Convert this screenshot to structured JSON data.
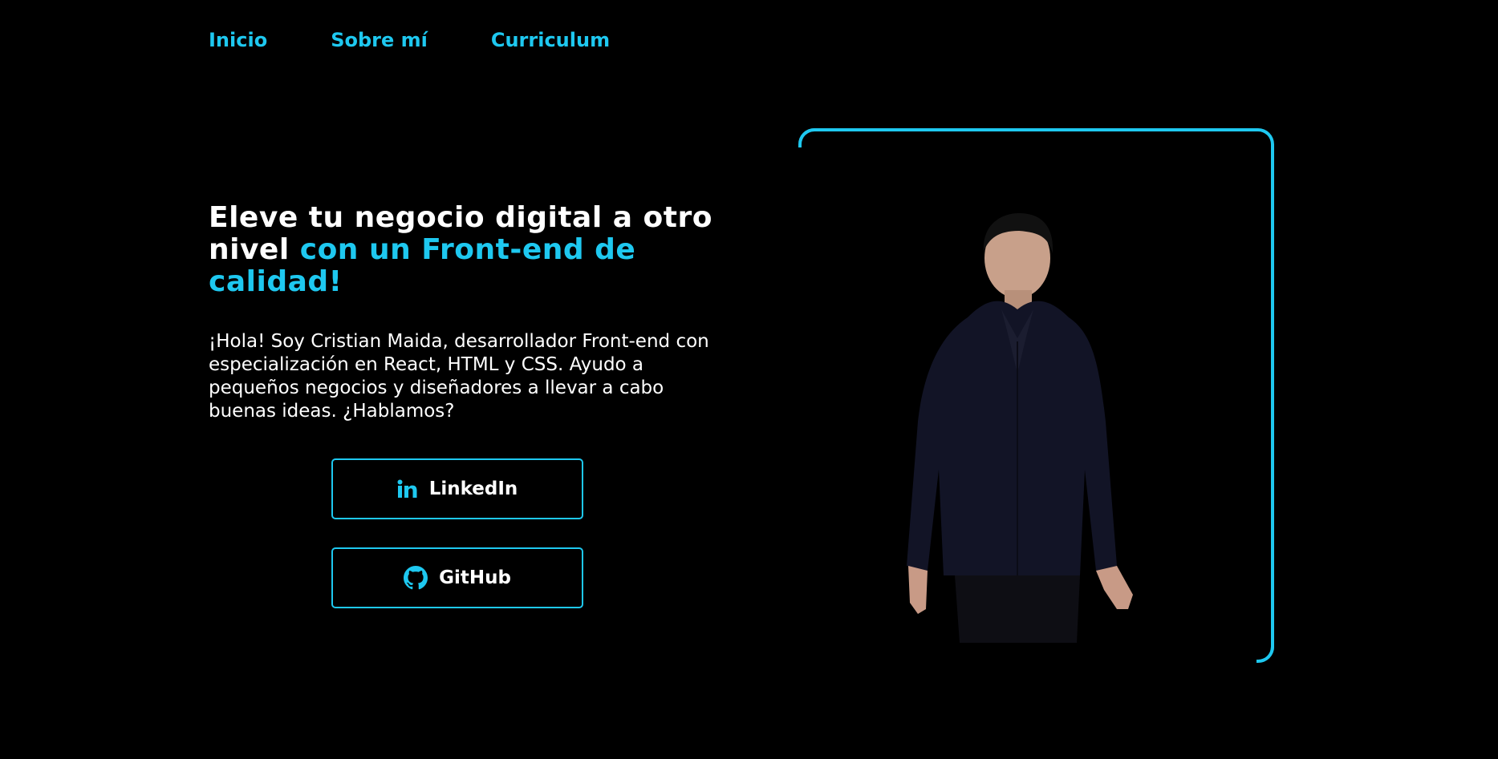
{
  "nav": {
    "items": [
      {
        "label": "Inicio"
      },
      {
        "label": "Sobre mí"
      },
      {
        "label": "Curriculum"
      }
    ]
  },
  "hero": {
    "headline_part1": "Eleve tu negocio digital a otro nivel ",
    "headline_part2": "con un Front-end de calidad!",
    "intro": "¡Hola! Soy Cristian Maida, desarrollador Front-end con especialización en React, HTML y CSS. Ayudo a pequeños negocios y diseñadores a llevar a cabo buenas ideas. ¿Hablamos?"
  },
  "buttons": {
    "linkedin": {
      "label": "LinkedIn",
      "icon": "linkedin-icon"
    },
    "github": {
      "label": "GitHub",
      "icon": "github-icon"
    }
  },
  "colors": {
    "accent": "#1ec8f0",
    "background": "#000000",
    "text": "#ffffff"
  }
}
